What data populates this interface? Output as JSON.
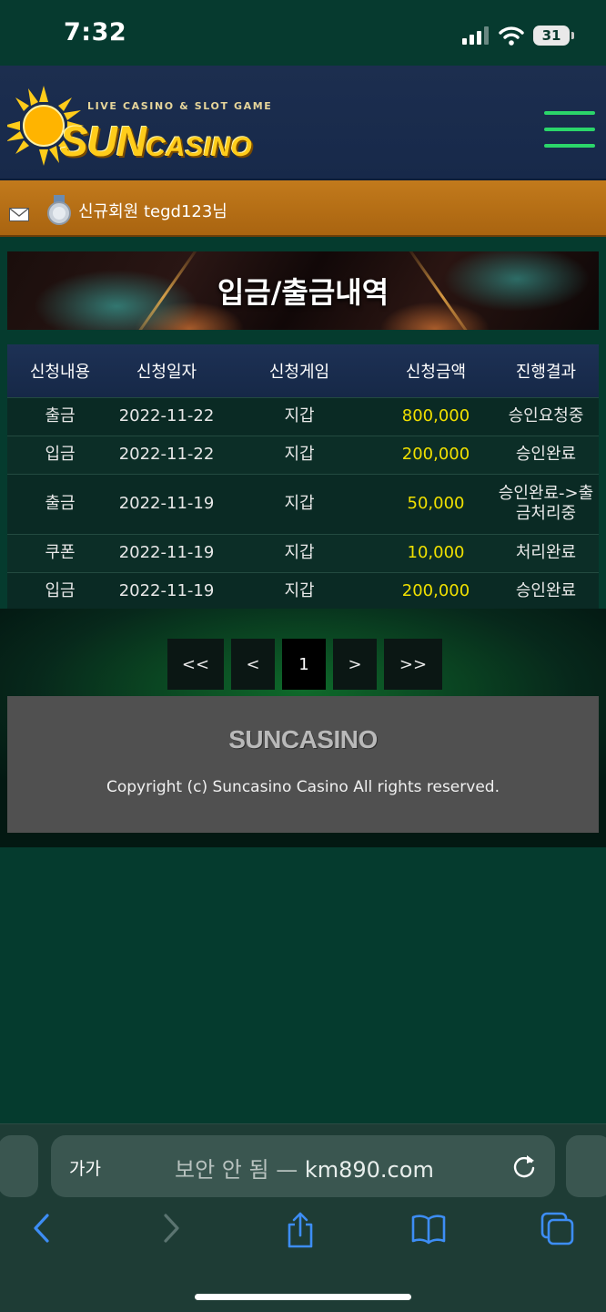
{
  "status_bar": {
    "time": "7:32",
    "battery": "31"
  },
  "header": {
    "logo_tagline": "LIVE CASINO & SLOT GAME",
    "logo_sun": "SUN",
    "logo_casino": "CASINO",
    "accent_color": "#2bd66a"
  },
  "member": {
    "text": "신규회원 tegd123님"
  },
  "banner": {
    "title": "입금/출금내역"
  },
  "table": {
    "headers": [
      "신청내용",
      "신청일자",
      "신청게임",
      "신청금액",
      "진행결과"
    ],
    "rows": [
      {
        "type": "출금",
        "date": "2022-11-22",
        "game": "지갑",
        "amount": "800,000",
        "status": "승인요청중"
      },
      {
        "type": "입금",
        "date": "2022-11-22",
        "game": "지갑",
        "amount": "200,000",
        "status": "승인완료"
      },
      {
        "type": "출금",
        "date": "2022-11-19",
        "game": "지갑",
        "amount": "50,000",
        "status": "승인완료->출금처리중"
      },
      {
        "type": "쿠폰",
        "date": "2022-11-19",
        "game": "지갑",
        "amount": "10,000",
        "status": "처리완료"
      },
      {
        "type": "입금",
        "date": "2022-11-19",
        "game": "지갑",
        "amount": "200,000",
        "status": "승인완료"
      }
    ]
  },
  "pagination": {
    "first": "<<",
    "prev": "<",
    "current": "1",
    "next": ">",
    "last": ">>"
  },
  "footer": {
    "logo": "SUNCASINO",
    "copyright": "Copyright (c) Suncasino Casino All rights reserved."
  },
  "browser": {
    "aa": "가가",
    "security_warning": "보안 안 됨",
    "separator": " — ",
    "url": "km890.com"
  }
}
